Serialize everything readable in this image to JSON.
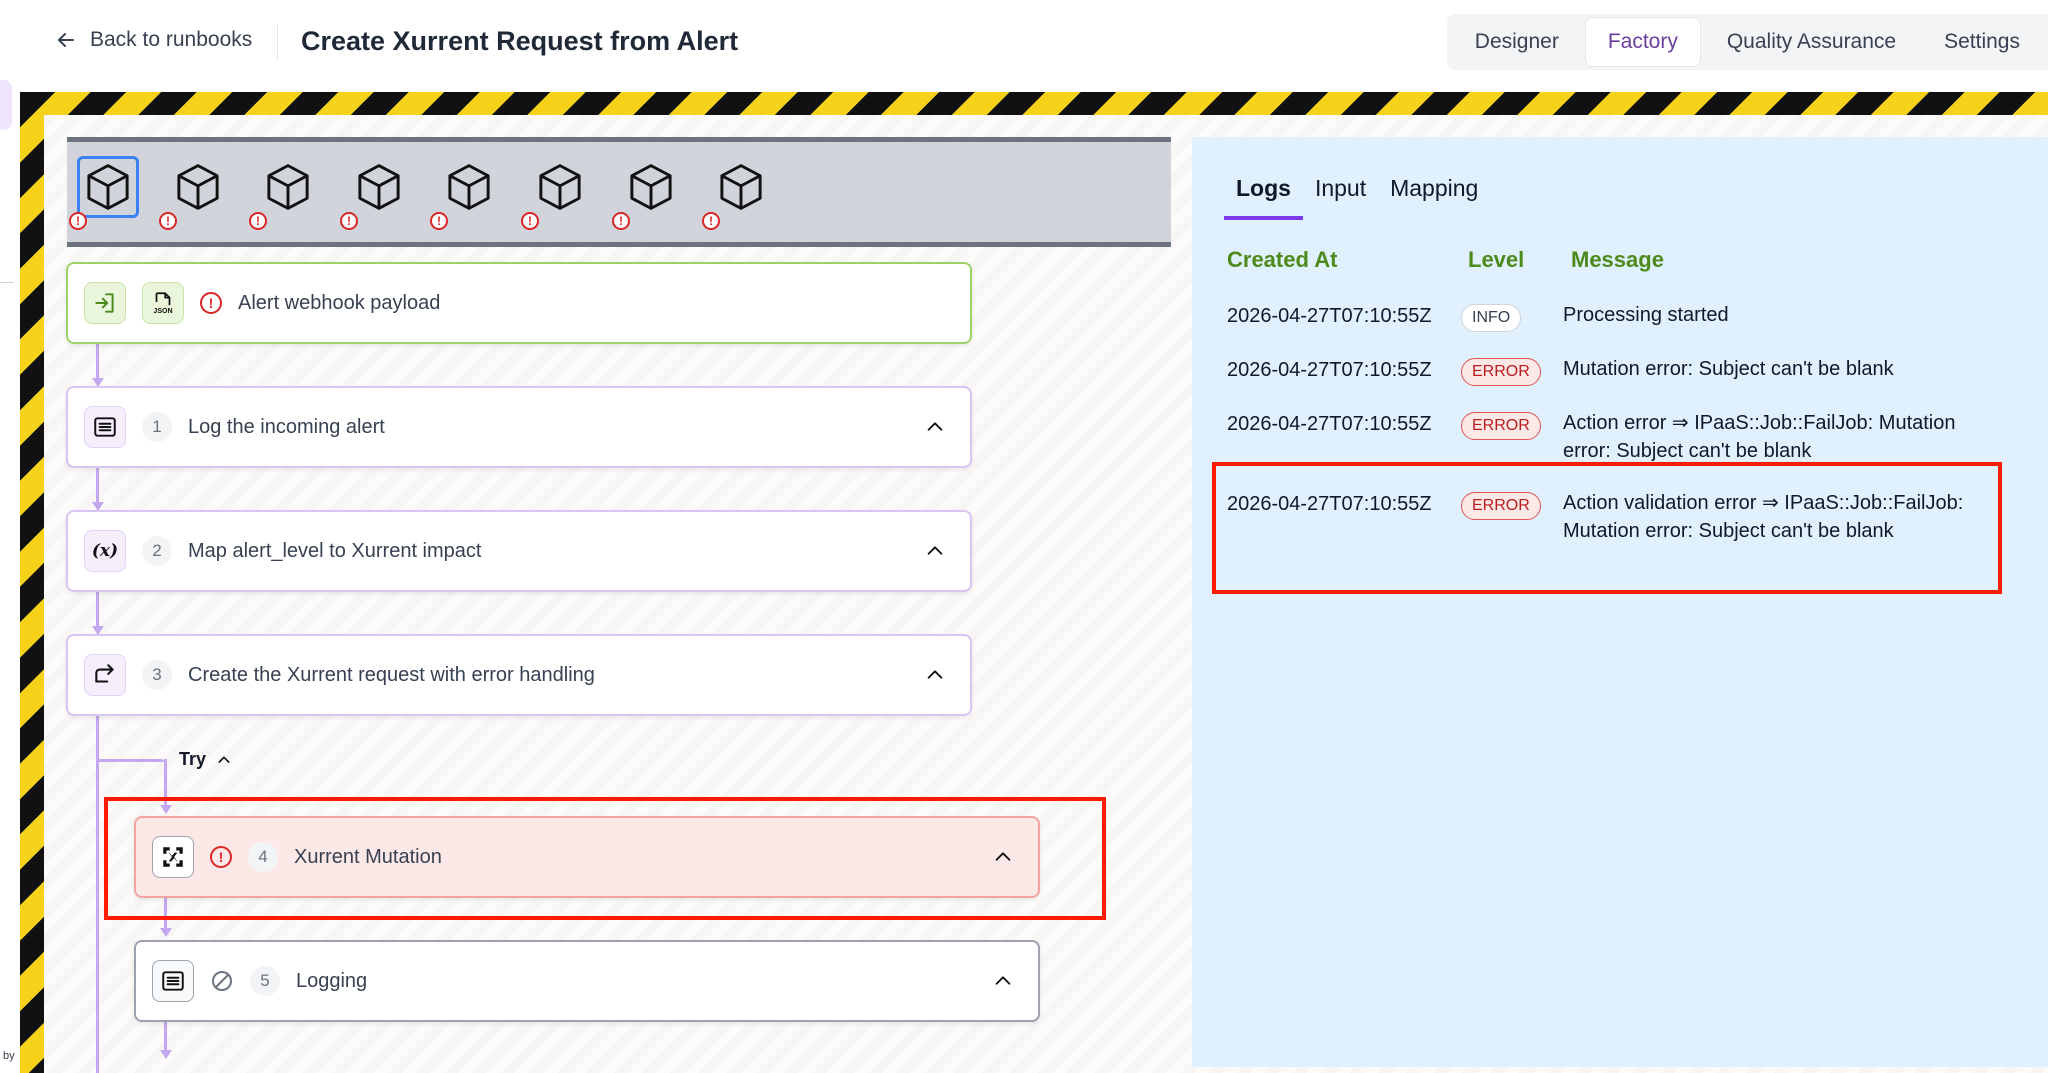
{
  "header": {
    "back_label": "Back to runbooks",
    "title": "Create Xurrent Request from Alert",
    "tabs": [
      {
        "label": "Designer",
        "active": false
      },
      {
        "label": "Factory",
        "active": true
      },
      {
        "label": "Quality Assurance",
        "active": false
      },
      {
        "label": "Settings",
        "active": false
      }
    ]
  },
  "edge": {
    "by_text": "by"
  },
  "jobs": {
    "count": 8,
    "selected_index": 0,
    "icon": "package-box-icon",
    "status_icon": "error-exclamation-icon"
  },
  "flow": {
    "trigger": {
      "label": "Alert webhook payload",
      "icon": "input-arrow-icon",
      "type_icon_text": "JSON"
    },
    "steps": [
      {
        "number": "1",
        "label": "Log the incoming alert",
        "icon": "log-lines-icon"
      },
      {
        "number": "2",
        "label": "Map alert_level to Xurrent impact",
        "icon": "variable-x-icon",
        "icon_text": "(x)"
      },
      {
        "number": "3",
        "label": "Create the Xurrent request with error handling",
        "icon": "redirect-arrow-icon"
      },
      {
        "number": "4",
        "label": "Xurrent Mutation",
        "icon": "xurrent-logo-icon",
        "status": "error"
      },
      {
        "number": "5",
        "label": "Logging",
        "icon": "log-lines-icon",
        "status": "disabled"
      }
    ],
    "try_label": "Try"
  },
  "logs": {
    "tabs": [
      {
        "label": "Logs",
        "active": true
      },
      {
        "label": "Input",
        "active": false
      },
      {
        "label": "Mapping",
        "active": false
      }
    ],
    "columns": [
      "Created At",
      "Level",
      "Message"
    ],
    "rows": [
      {
        "created_at": "2026-04-27T07:10:55Z",
        "level": "INFO",
        "message": "Processing started"
      },
      {
        "created_at": "2026-04-27T07:10:55Z",
        "level": "ERROR",
        "message": "Mutation error: Subject can't be blank"
      },
      {
        "created_at": "2026-04-27T07:10:55Z",
        "level": "ERROR",
        "message": "Action error ⇒ IPaaS::Job::FailJob: Mutation error: Subject can't be blank"
      },
      {
        "created_at": "2026-04-27T07:10:55Z",
        "level": "ERROR",
        "message": "Action validation error ⇒ IPaaS::Job::FailJob: Mutation error: Subject can't be blank"
      }
    ]
  },
  "colors": {
    "accent_purple": "#7c3aed",
    "hazard_yellow": "#f7d21a",
    "hazard_black": "#111111",
    "error_red": "#dc2626",
    "annotation_red": "#ff1a00",
    "logs_panel_bg": "#e0f0fc",
    "column_header_green": "#4d8a1b"
  }
}
